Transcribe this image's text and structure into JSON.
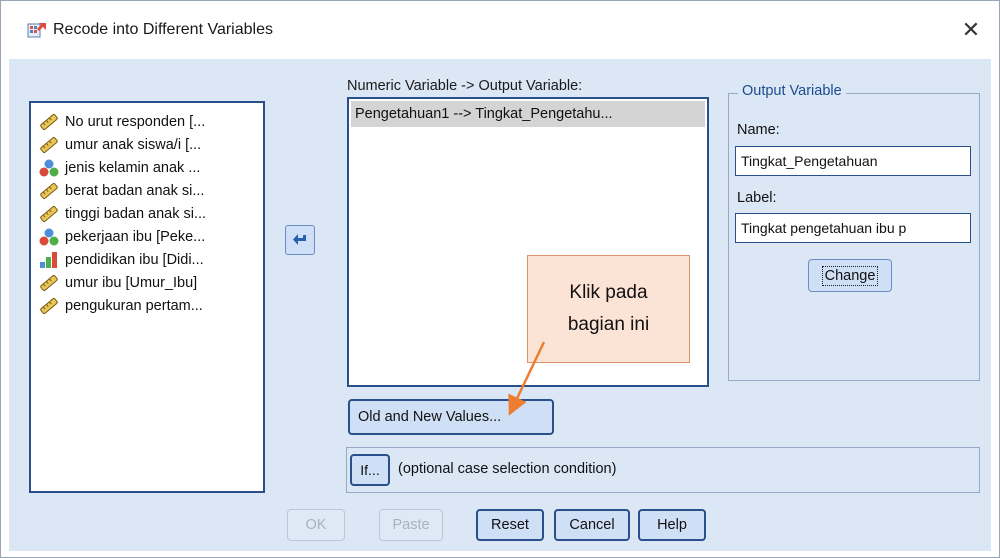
{
  "window": {
    "title": "Recode into Different Variables",
    "app_icon": "recode-app-icon",
    "close_glyph": "✕"
  },
  "source_list": {
    "items": [
      {
        "label": "No urut responden [...",
        "icon": "scale-ruler-icon"
      },
      {
        "label": "umur anak siswa/i [...",
        "icon": "scale-ruler-icon"
      },
      {
        "label": "jenis kelamin anak ...",
        "icon": "nominal-balls-icon"
      },
      {
        "label": "berat badan anak si...",
        "icon": "scale-ruler-icon"
      },
      {
        "label": "tinggi badan anak si...",
        "icon": "scale-ruler-icon"
      },
      {
        "label": "pekerjaan ibu [Peke...",
        "icon": "nominal-balls-icon"
      },
      {
        "label": "pendidikan ibu [Didi...",
        "icon": "ordinal-bars-icon"
      },
      {
        "label": "umur ibu [Umur_Ibu]",
        "icon": "scale-ruler-icon"
      },
      {
        "label": "pengukuran pertam...",
        "icon": "scale-ruler-icon"
      }
    ]
  },
  "move_button": {
    "icon": "arrow-left-icon"
  },
  "numeric_variable": {
    "label": "Numeric Variable -> Output Variable:",
    "items": [
      "Pengetahuan1 --> Tingkat_Pengetahu..."
    ]
  },
  "output_variable": {
    "legend": "Output Variable",
    "name_label": "Name:",
    "name_value": "Tingkat_Pengetahuan",
    "label_label": "Label:",
    "label_value": "Tingkat pengetahuan ibu p",
    "change_button": "Change"
  },
  "callout": {
    "line1": "Klik pada",
    "line2": "bagian ini"
  },
  "old_new_button": "Old and New Values...",
  "if_section": {
    "button": "If...",
    "text": "(optional case selection condition)"
  },
  "buttons": {
    "ok": "OK",
    "paste": "Paste",
    "reset": "Reset",
    "cancel": "Cancel",
    "help": "Help"
  },
  "colors": {
    "dialog_bg": "#dce7f5",
    "button_bg": "#cfe0f6",
    "focus_border": "#2a4f8a",
    "callout_bg": "#fbe4d5",
    "arrow": "#ed7d31"
  }
}
